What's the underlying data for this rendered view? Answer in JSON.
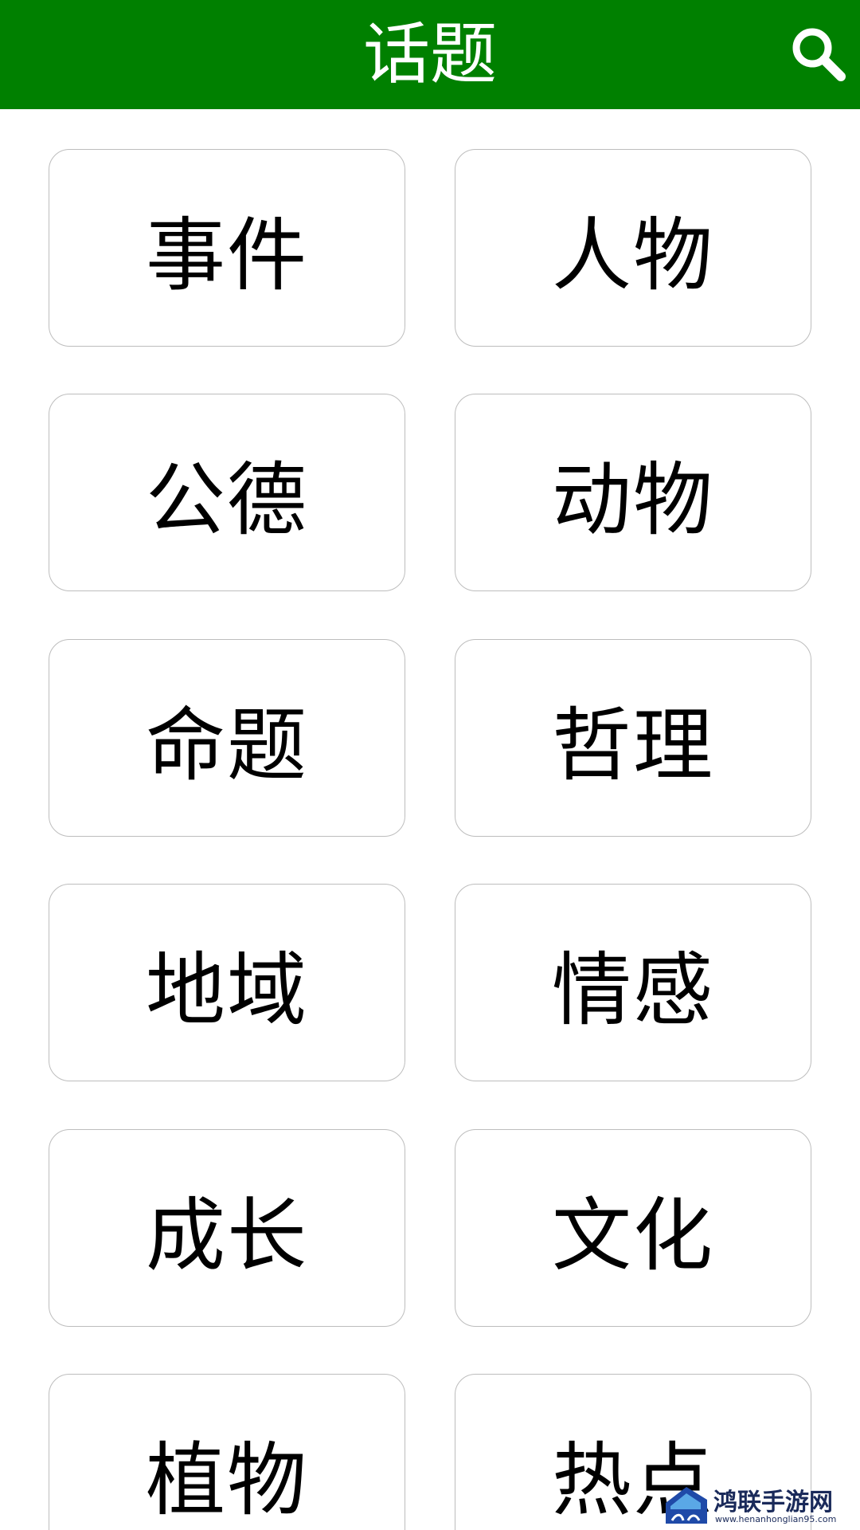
{
  "header": {
    "title": "话题",
    "search_icon": "search-icon",
    "background_color": "#008000",
    "title_color": "#ffffff"
  },
  "topics": [
    {
      "label": "事件"
    },
    {
      "label": "人物"
    },
    {
      "label": "公德"
    },
    {
      "label": "动物"
    },
    {
      "label": "命题"
    },
    {
      "label": "哲理"
    },
    {
      "label": "地域"
    },
    {
      "label": "情感"
    },
    {
      "label": "成长"
    },
    {
      "label": "文化"
    },
    {
      "label": "植物"
    },
    {
      "label": "热点"
    }
  ],
  "watermark": {
    "title": "鸿联手游网",
    "url": "www.henanhonglian95.com"
  }
}
